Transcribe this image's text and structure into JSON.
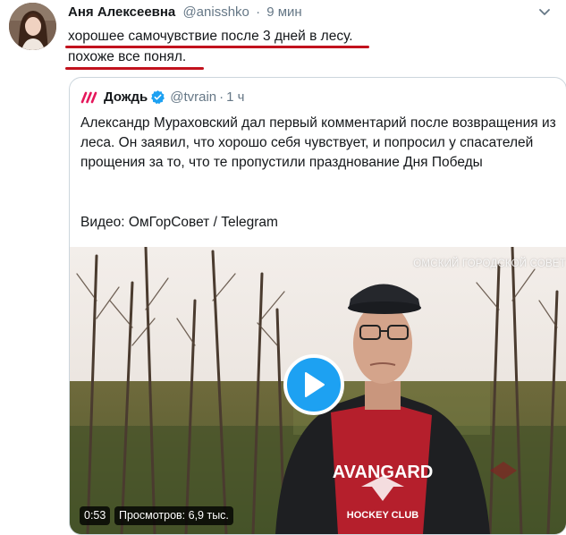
{
  "tweet": {
    "author_name": "Аня Алексеевна",
    "author_handle": "@anisshko",
    "separator": "·",
    "time": "9 мин",
    "text_line1": "хорошее самочувствие после 3 дней в лесу.",
    "text_line2": "похоже все понял.",
    "underline_color": "#c2121d"
  },
  "quoted_tweet": {
    "author_name": "Дождь",
    "author_handle": "@tvrain",
    "separator": "·",
    "time": "1 ч",
    "text": "Александр Мураховский дал первый комментарий после возвращения из леса. Он заявил, что хорошо себя чувствует, и попросил у спасателей прощения за то, что те пропустили празднование Дня Победы",
    "credit": "Видео: ОмГорСовет / Telegram",
    "brand_color": "#e5175b",
    "verified_color": "#1da1f2"
  },
  "video": {
    "watermark": "ОМСКИЙ ГОРОДСКОЙ СОВЕТ",
    "shirt_text": "AVANGARD",
    "shirt_subtext": "HOCKEY CLUB",
    "duration": "0:53",
    "views": "Просмотров: 6,9 тыс.",
    "play_color": "#1da1f2"
  },
  "icons": {
    "caret": "chevron-down-icon",
    "play": "play-icon",
    "verified": "verified-badge-icon",
    "brand": "tvrain-logo-icon"
  }
}
